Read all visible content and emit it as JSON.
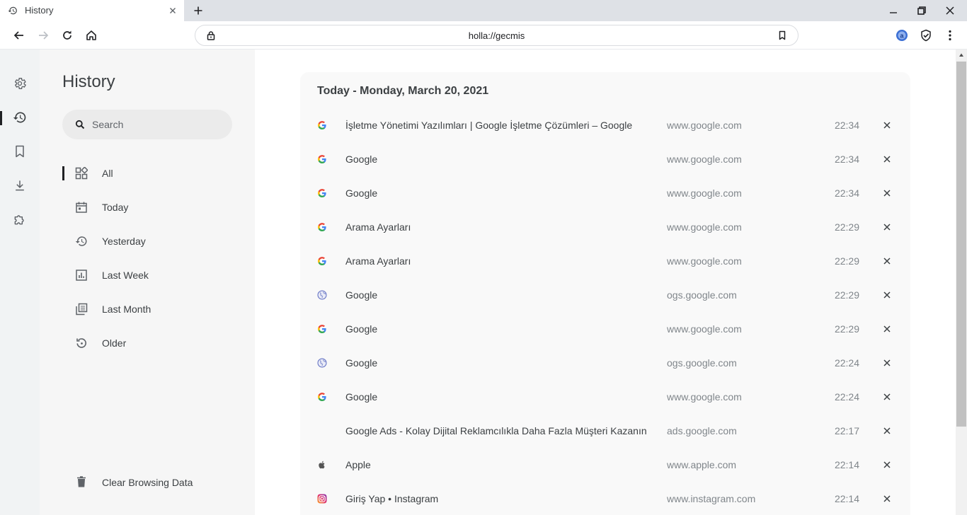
{
  "browser": {
    "tab": {
      "title": "History",
      "icon": "history-icon"
    },
    "new_tab": "plus-icon",
    "window_controls": [
      "minimize-icon",
      "restore-icon",
      "close-icon"
    ],
    "nav": [
      "back-icon",
      "forward-icon",
      "reload-icon",
      "home-icon"
    ],
    "url": "holla://gecmis",
    "extensions": [
      "account-icon",
      "shield-check-icon",
      "kebab-menu-icon"
    ]
  },
  "rail": {
    "items": [
      "gear-icon",
      "history-icon",
      "bookmark-icon",
      "download-icon",
      "puzzle-icon"
    ],
    "active": "history-icon"
  },
  "sidebar": {
    "title": "History",
    "search": {
      "placeholder": "Search"
    },
    "filters": [
      {
        "label": "All",
        "icon": "grid-icon",
        "active": true
      },
      {
        "label": "Today",
        "icon": "calendar-icon"
      },
      {
        "label": "Yesterday",
        "icon": "history-icon"
      },
      {
        "label": "Last Week",
        "icon": "chart-icon"
      },
      {
        "label": "Last Month",
        "icon": "stack-icon"
      },
      {
        "label": "Older",
        "icon": "restore-icon"
      }
    ],
    "clear_label": "Clear Browsing Data"
  },
  "history": {
    "heading": "Today - Monday, March 20, 2021",
    "entries": [
      {
        "title": "İşletme Yönetimi Yazılımları | Google İşletme Çözümleri – Google",
        "domain": "www.google.com",
        "time": "22:34",
        "icon": "google-icon"
      },
      {
        "title": "Google",
        "domain": "www.google.com",
        "time": "22:34",
        "icon": "google-icon"
      },
      {
        "title": "Google",
        "domain": "www.google.com",
        "time": "22:34",
        "icon": "google-icon"
      },
      {
        "title": "Arama Ayarları",
        "domain": "www.google.com",
        "time": "22:29",
        "icon": "google-icon"
      },
      {
        "title": "Arama Ayarları",
        "domain": "www.google.com",
        "time": "22:29",
        "icon": "google-icon"
      },
      {
        "title": "Google",
        "domain": "ogs.google.com",
        "time": "22:29",
        "icon": "globe-icon"
      },
      {
        "title": "Google",
        "domain": "www.google.com",
        "time": "22:29",
        "icon": "google-icon"
      },
      {
        "title": "Google",
        "domain": "ogs.google.com",
        "time": "22:24",
        "icon": "globe-icon"
      },
      {
        "title": "Google",
        "domain": "www.google.com",
        "time": "22:24",
        "icon": "google-icon"
      },
      {
        "title": "Google Ads - Kolay Dijital Reklamcılıkla Daha Fazla Müşteri Kazanın",
        "domain": "ads.google.com",
        "time": "22:17",
        "icon": "none"
      },
      {
        "title": "Apple",
        "domain": "www.apple.com",
        "time": "22:14",
        "icon": "apple-icon"
      },
      {
        "title": "Giriş Yap • Instagram",
        "domain": "www.instagram.com",
        "time": "22:14",
        "icon": "instagram-icon"
      }
    ]
  }
}
